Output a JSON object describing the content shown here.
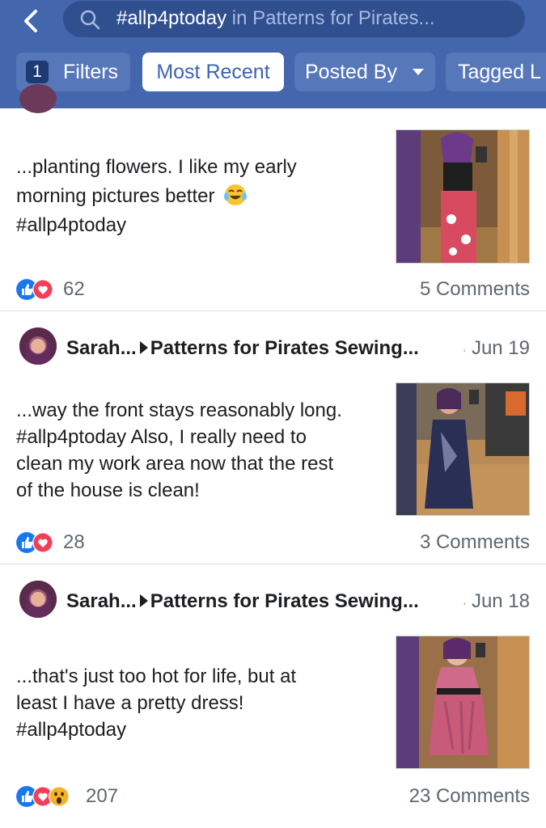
{
  "search": {
    "query": "#allp4ptoday",
    "scope": " in Patterns for Pirates..."
  },
  "filters": {
    "count": "1",
    "filters_label": "Filters",
    "most_recent_label": "Most Recent",
    "posted_by_label": "Posted By",
    "tagged_label": "Tagged L"
  },
  "posts": [
    {
      "text_lines": [
        "...planting flowers. I like my early",
        "morning pictures better",
        "#allp4ptoday"
      ],
      "emoji": "crying-laughing-emoji",
      "reactions_count": "62",
      "comments": "5 Comments"
    },
    {
      "author": "Sarah...",
      "group": "Patterns for Pirates Sewing...",
      "date": "Jun 19",
      "text_lines": [
        "...way the front stays reasonably long.",
        "#allp4ptoday Also, I really need to",
        "clean my work area now that the rest",
        "of the house is clean!"
      ],
      "reactions_count": "28",
      "comments": "3 Comments"
    },
    {
      "author": "Sarah...",
      "group": "Patterns for Pirates Sewing...",
      "date": "Jun 18",
      "text_lines": [
        "...that's just too hot for life, but at",
        "least I have a pretty dress!",
        "#allp4ptoday"
      ],
      "reactions_count": "207",
      "comments": "23 Comments"
    }
  ],
  "colors": {
    "header": "#4366ad",
    "like": "#1877f2",
    "love": "#f33e58",
    "wow": "#f7b125"
  }
}
